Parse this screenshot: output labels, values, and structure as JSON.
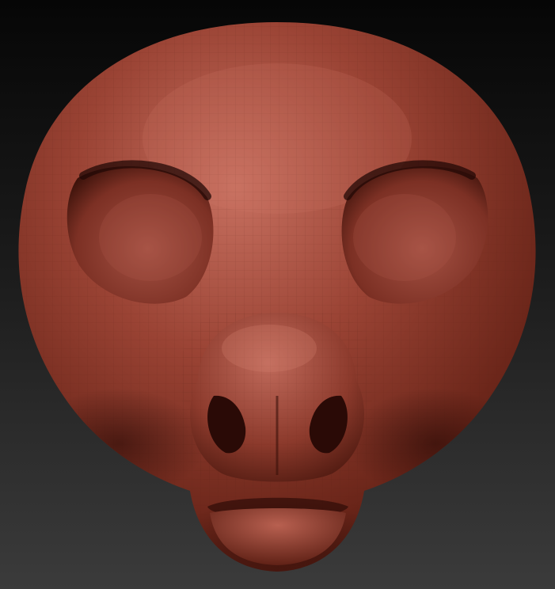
{
  "scene": {
    "subject": "sculpted-creature-head",
    "colors": {
      "background_top": "#060606",
      "background_bottom": "#3b3b3b",
      "clay_base": "#8e3a2c",
      "clay_highlight": "#c77060",
      "clay_shadow": "#2a0b07",
      "wireframe": "#5a2016"
    }
  }
}
